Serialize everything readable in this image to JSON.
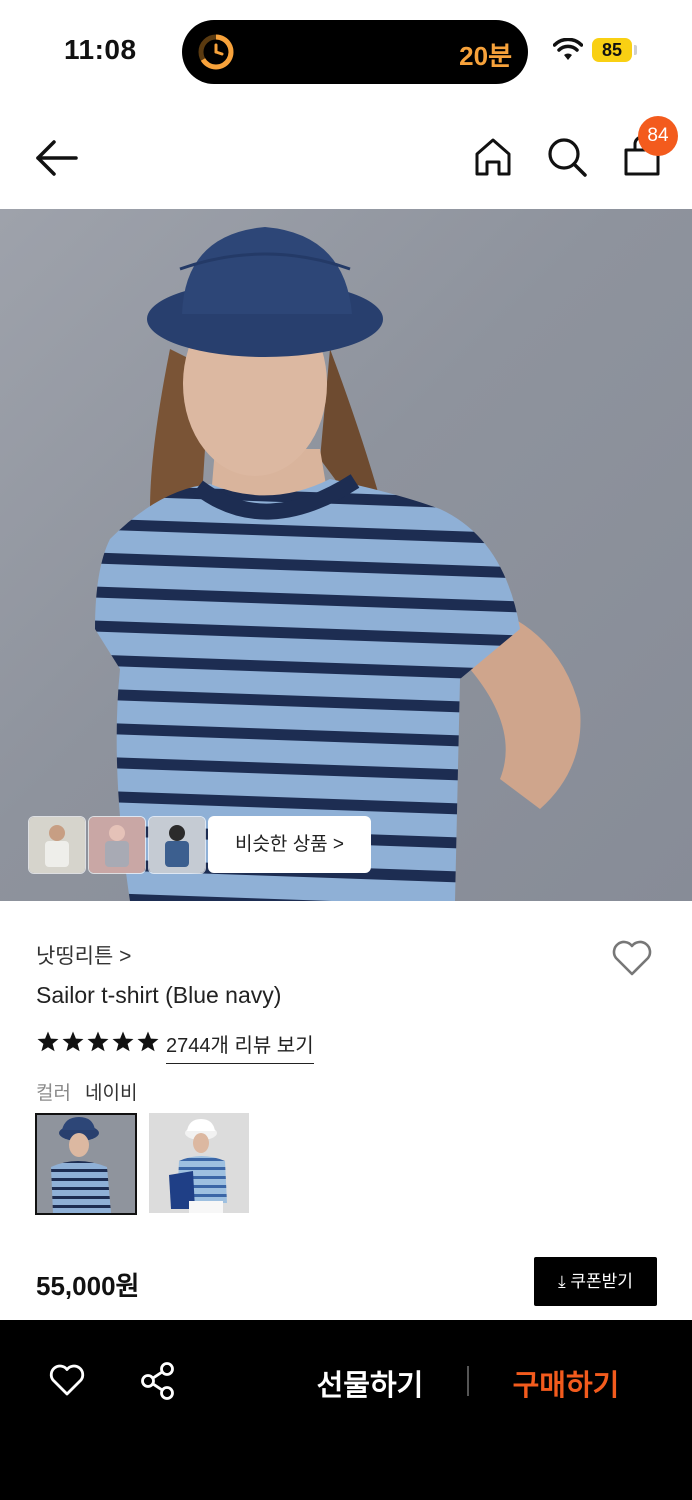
{
  "status_bar": {
    "time": "11:08",
    "island_text": "20분",
    "battery": "85"
  },
  "nav": {
    "cart_count": "84"
  },
  "hero": {
    "similar_label": "비슷한 상품 >"
  },
  "product": {
    "brand": "낫띵리튼 >",
    "name": "Sailor t-shirt (Blue navy)",
    "rating_stars": 5,
    "review_link": "2744개 리뷰 보기",
    "color_label": "컬러",
    "color_value": "네이비",
    "price": "55,000원",
    "coupon_label": "⤓ 쿠폰받기"
  },
  "bottom_bar": {
    "gift_label": "선물하기",
    "buy_label": "구매하기"
  },
  "colors": {
    "accent": "#f35b1d",
    "island_text": "#f7a23b",
    "battery": "#f9d013"
  }
}
